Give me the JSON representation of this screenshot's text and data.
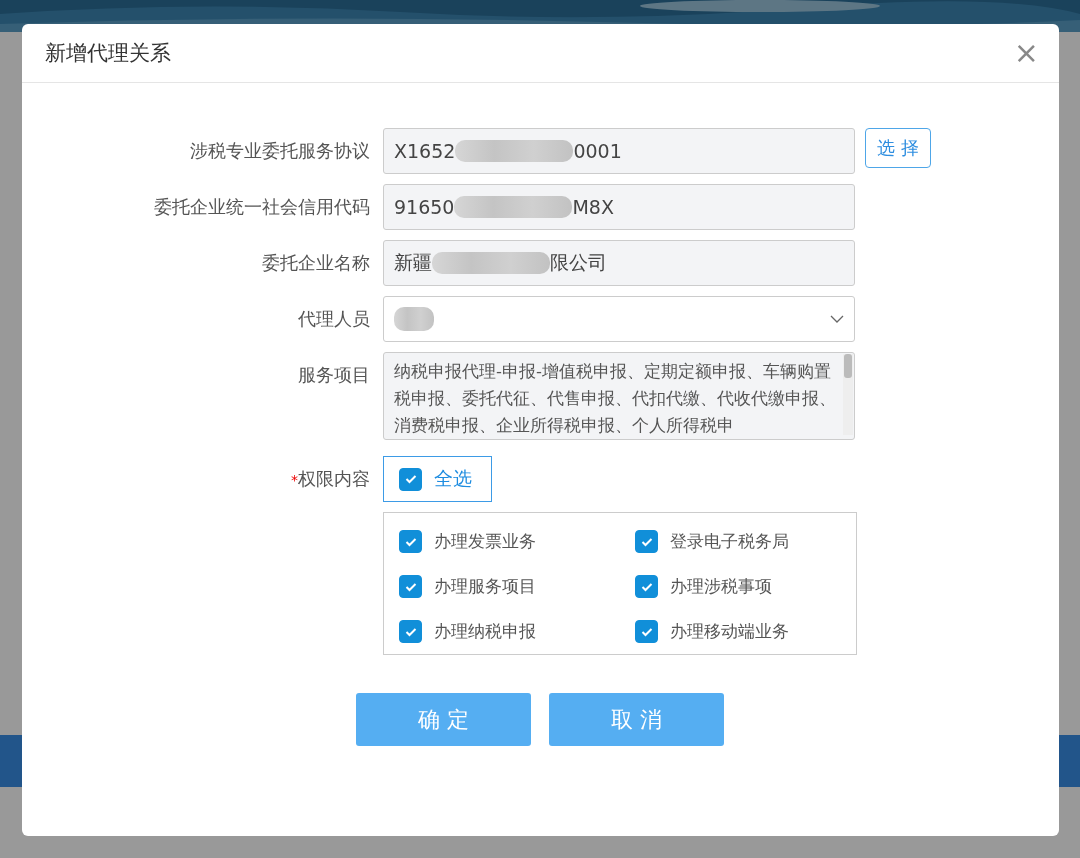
{
  "dialog": {
    "title": "新增代理关系",
    "close": "×"
  },
  "fields": [
    {
      "kind": "readonly",
      "label": "涉税专业委托服务协议",
      "prefix": "X1652",
      "suffix": "0001",
      "redacted": true,
      "button": "选 择"
    },
    {
      "kind": "readonly",
      "label": "委托企业统一社会信用代码",
      "prefix": "91650",
      "suffix": "M8X",
      "redacted": true
    },
    {
      "kind": "readonly",
      "label": "委托企业名称",
      "prefix": "新疆",
      "suffix": "限公司",
      "redacted": true
    },
    {
      "kind": "select",
      "label": "代理人员",
      "redacted": true
    },
    {
      "kind": "textarea",
      "label": "服务项目",
      "value": "纳税申报代理-申报-增值税申报、定期定额申报、车辆购置税申报、委托代征、代售申报、代扣代缴、代收代缴申报、消费税申报、企业所得税申报、个人所得税申"
    }
  ],
  "permissions": {
    "label": "权限内容",
    "required_mark": "*",
    "select_all": {
      "label": "全选",
      "checked": true
    },
    "items": [
      {
        "label": "办理发票业务",
        "checked": true
      },
      {
        "label": "登录电子税务局",
        "checked": true
      },
      {
        "label": "办理服务项目",
        "checked": true
      },
      {
        "label": "办理涉税事项",
        "checked": true
      },
      {
        "label": "办理纳税申报",
        "checked": true
      },
      {
        "label": "办理移动端业务",
        "checked": true
      }
    ]
  },
  "buttons": [
    "确 定",
    "取 消"
  ]
}
